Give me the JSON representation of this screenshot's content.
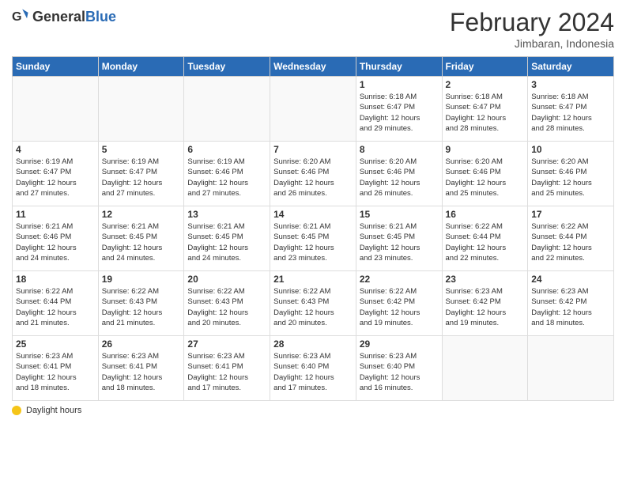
{
  "header": {
    "logo_general": "General",
    "logo_blue": "Blue",
    "title": "February 2024",
    "subtitle": "Jimbaran, Indonesia"
  },
  "days_of_week": [
    "Sunday",
    "Monday",
    "Tuesday",
    "Wednesday",
    "Thursday",
    "Friday",
    "Saturday"
  ],
  "weeks": [
    [
      {
        "day": "",
        "info": ""
      },
      {
        "day": "",
        "info": ""
      },
      {
        "day": "",
        "info": ""
      },
      {
        "day": "",
        "info": ""
      },
      {
        "day": "1",
        "info": "Sunrise: 6:18 AM\nSunset: 6:47 PM\nDaylight: 12 hours\nand 29 minutes."
      },
      {
        "day": "2",
        "info": "Sunrise: 6:18 AM\nSunset: 6:47 PM\nDaylight: 12 hours\nand 28 minutes."
      },
      {
        "day": "3",
        "info": "Sunrise: 6:18 AM\nSunset: 6:47 PM\nDaylight: 12 hours\nand 28 minutes."
      }
    ],
    [
      {
        "day": "4",
        "info": "Sunrise: 6:19 AM\nSunset: 6:47 PM\nDaylight: 12 hours\nand 27 minutes."
      },
      {
        "day": "5",
        "info": "Sunrise: 6:19 AM\nSunset: 6:47 PM\nDaylight: 12 hours\nand 27 minutes."
      },
      {
        "day": "6",
        "info": "Sunrise: 6:19 AM\nSunset: 6:46 PM\nDaylight: 12 hours\nand 27 minutes."
      },
      {
        "day": "7",
        "info": "Sunrise: 6:20 AM\nSunset: 6:46 PM\nDaylight: 12 hours\nand 26 minutes."
      },
      {
        "day": "8",
        "info": "Sunrise: 6:20 AM\nSunset: 6:46 PM\nDaylight: 12 hours\nand 26 minutes."
      },
      {
        "day": "9",
        "info": "Sunrise: 6:20 AM\nSunset: 6:46 PM\nDaylight: 12 hours\nand 25 minutes."
      },
      {
        "day": "10",
        "info": "Sunrise: 6:20 AM\nSunset: 6:46 PM\nDaylight: 12 hours\nand 25 minutes."
      }
    ],
    [
      {
        "day": "11",
        "info": "Sunrise: 6:21 AM\nSunset: 6:46 PM\nDaylight: 12 hours\nand 24 minutes."
      },
      {
        "day": "12",
        "info": "Sunrise: 6:21 AM\nSunset: 6:45 PM\nDaylight: 12 hours\nand 24 minutes."
      },
      {
        "day": "13",
        "info": "Sunrise: 6:21 AM\nSunset: 6:45 PM\nDaylight: 12 hours\nand 24 minutes."
      },
      {
        "day": "14",
        "info": "Sunrise: 6:21 AM\nSunset: 6:45 PM\nDaylight: 12 hours\nand 23 minutes."
      },
      {
        "day": "15",
        "info": "Sunrise: 6:21 AM\nSunset: 6:45 PM\nDaylight: 12 hours\nand 23 minutes."
      },
      {
        "day": "16",
        "info": "Sunrise: 6:22 AM\nSunset: 6:44 PM\nDaylight: 12 hours\nand 22 minutes."
      },
      {
        "day": "17",
        "info": "Sunrise: 6:22 AM\nSunset: 6:44 PM\nDaylight: 12 hours\nand 22 minutes."
      }
    ],
    [
      {
        "day": "18",
        "info": "Sunrise: 6:22 AM\nSunset: 6:44 PM\nDaylight: 12 hours\nand 21 minutes."
      },
      {
        "day": "19",
        "info": "Sunrise: 6:22 AM\nSunset: 6:43 PM\nDaylight: 12 hours\nand 21 minutes."
      },
      {
        "day": "20",
        "info": "Sunrise: 6:22 AM\nSunset: 6:43 PM\nDaylight: 12 hours\nand 20 minutes."
      },
      {
        "day": "21",
        "info": "Sunrise: 6:22 AM\nSunset: 6:43 PM\nDaylight: 12 hours\nand 20 minutes."
      },
      {
        "day": "22",
        "info": "Sunrise: 6:22 AM\nSunset: 6:42 PM\nDaylight: 12 hours\nand 19 minutes."
      },
      {
        "day": "23",
        "info": "Sunrise: 6:23 AM\nSunset: 6:42 PM\nDaylight: 12 hours\nand 19 minutes."
      },
      {
        "day": "24",
        "info": "Sunrise: 6:23 AM\nSunset: 6:42 PM\nDaylight: 12 hours\nand 18 minutes."
      }
    ],
    [
      {
        "day": "25",
        "info": "Sunrise: 6:23 AM\nSunset: 6:41 PM\nDaylight: 12 hours\nand 18 minutes."
      },
      {
        "day": "26",
        "info": "Sunrise: 6:23 AM\nSunset: 6:41 PM\nDaylight: 12 hours\nand 18 minutes."
      },
      {
        "day": "27",
        "info": "Sunrise: 6:23 AM\nSunset: 6:41 PM\nDaylight: 12 hours\nand 17 minutes."
      },
      {
        "day": "28",
        "info": "Sunrise: 6:23 AM\nSunset: 6:40 PM\nDaylight: 12 hours\nand 17 minutes."
      },
      {
        "day": "29",
        "info": "Sunrise: 6:23 AM\nSunset: 6:40 PM\nDaylight: 12 hours\nand 16 minutes."
      },
      {
        "day": "",
        "info": ""
      },
      {
        "day": "",
        "info": ""
      }
    ]
  ],
  "footer": {
    "icon_label": "sun-icon",
    "text": "Daylight hours"
  }
}
